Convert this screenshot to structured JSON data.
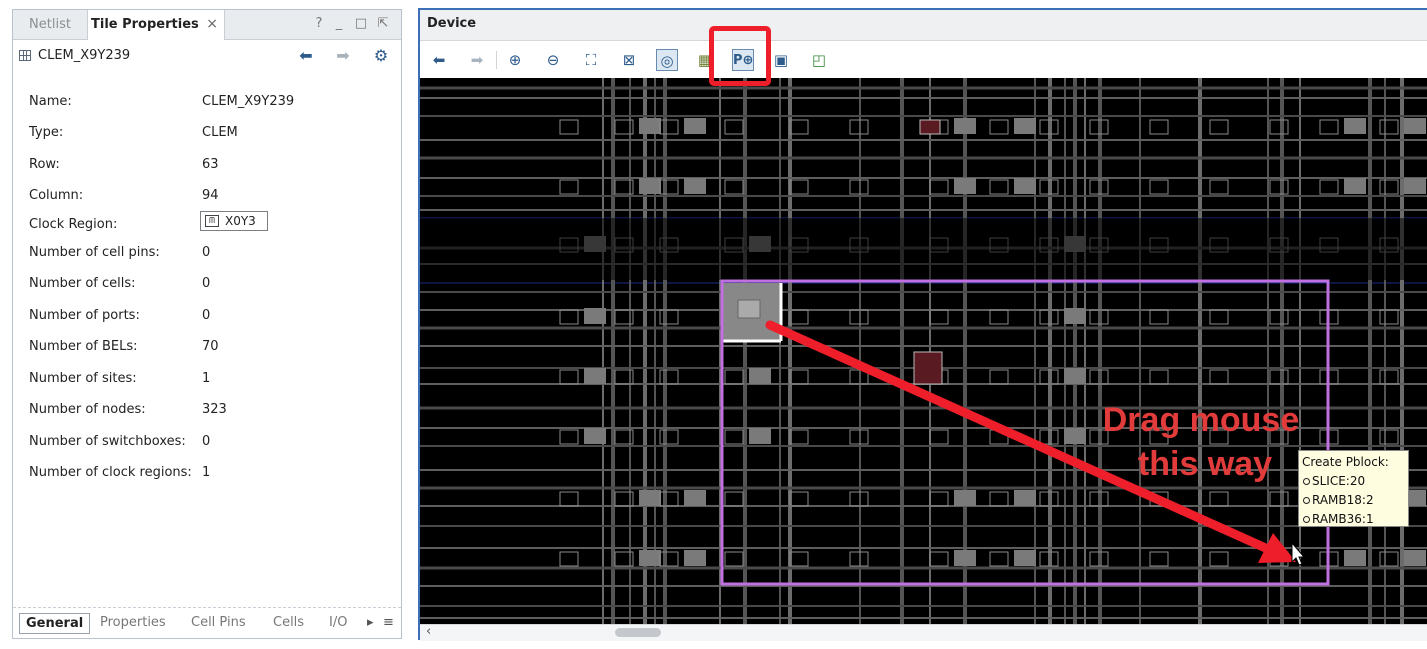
{
  "left_panel": {
    "tabs": [
      {
        "label": "Netlist",
        "active": false
      },
      {
        "label": "Tile Properties",
        "active": true
      }
    ],
    "window_controls": [
      "?",
      "_",
      "□",
      "⇱"
    ],
    "tile_name": "CLEM_X9Y239",
    "properties": [
      {
        "label": "Name:",
        "value": "CLEM_X9Y239"
      },
      {
        "label": "Type:",
        "value": "CLEM"
      },
      {
        "label": "Row:",
        "value": "63"
      },
      {
        "label": "Column:",
        "value": "94"
      },
      {
        "label": "Clock Region:",
        "value": "X0Y3"
      },
      {
        "label": "Number of cell pins:",
        "value": "0"
      },
      {
        "label": "Number of cells:",
        "value": "0"
      },
      {
        "label": "Number of ports:",
        "value": "0"
      },
      {
        "label": "Number of BELs:",
        "value": "70"
      },
      {
        "label": "Number of sites:",
        "value": "1"
      },
      {
        "label": "Number of nodes:",
        "value": "323"
      },
      {
        "label": "Number of switchboxes:",
        "value": "0"
      },
      {
        "label": "Number of clock regions:",
        "value": "1"
      }
    ],
    "bottom_tabs": [
      "General",
      "Properties",
      "Cell Pins",
      "Cells",
      "I/O"
    ]
  },
  "device": {
    "title": "Device",
    "toolbar": [
      "back-icon",
      "forward-icon",
      "zoom-in-icon",
      "zoom-out-icon",
      "zoom-fit-icon",
      "zoom-selection-icon",
      "auto-fit-icon",
      "routing-resources-icon",
      "draw-pblock-icon",
      "select-area-icon",
      "add-element-icon"
    ],
    "tooltip": {
      "title": "Create Pblock:",
      "items": [
        "SLICE:20",
        "RAMB18:2",
        "RAMB36:1"
      ]
    },
    "annotation": [
      "Drag mouse",
      "this way"
    ]
  },
  "colors": {
    "accent": "#3d6fb6",
    "highlight": "#ee1e2a",
    "pblock": "#c070e0",
    "annotation": "#e23b3b"
  }
}
